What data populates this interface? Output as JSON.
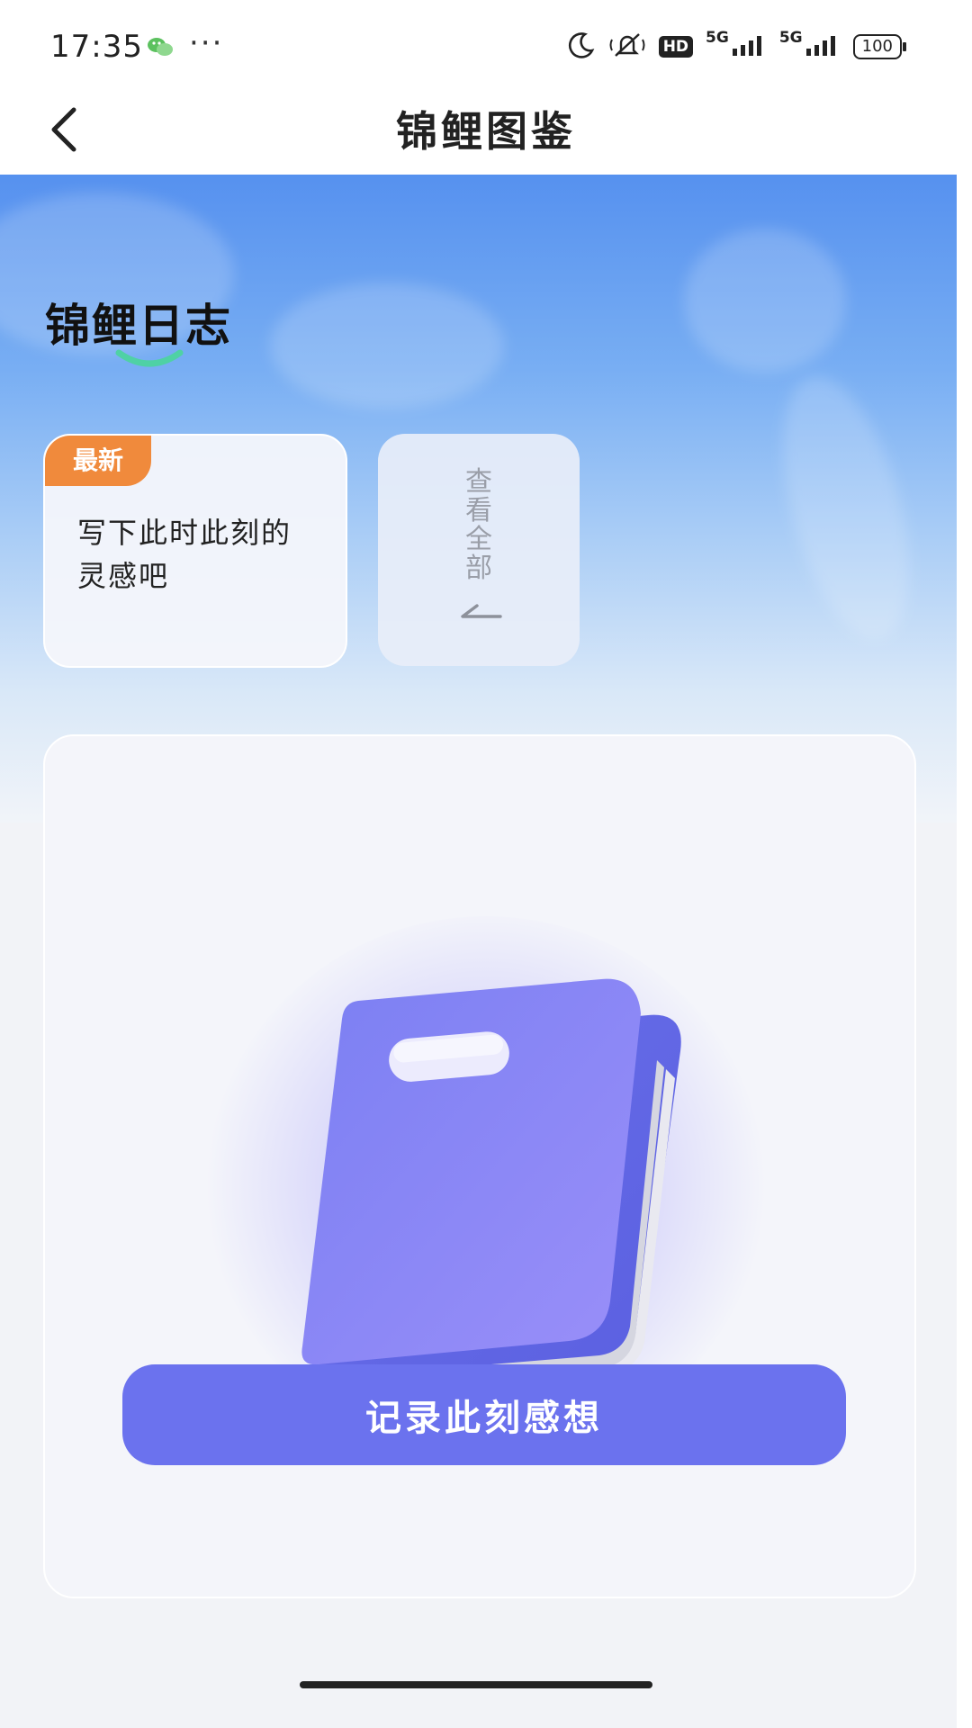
{
  "status_bar": {
    "time": "17:35",
    "more": "···",
    "hd": "HD",
    "net1": "5G",
    "net2": "5G",
    "battery": "100",
    "icons": [
      "wechat-icon",
      "moon-icon",
      "mute-icon",
      "signal-icon",
      "battery-icon"
    ]
  },
  "nav": {
    "title": "锦鲤图鉴",
    "back_icon": "chevron-left-icon"
  },
  "section": {
    "title": "锦鲤日志"
  },
  "latest_card": {
    "badge": "最新",
    "text": "写下此时此刻的灵感吧"
  },
  "view_all_card": {
    "label": "查看全部",
    "arrow_icon": "arrow-icon"
  },
  "panel": {
    "illustration": "notebook-illustration",
    "record_button": "记录此刻感想"
  },
  "colors": {
    "accent": "#6b72ee",
    "badge": "#f08a3c",
    "underline": "#4fd1a5",
    "hero_top": "#5691ef"
  }
}
